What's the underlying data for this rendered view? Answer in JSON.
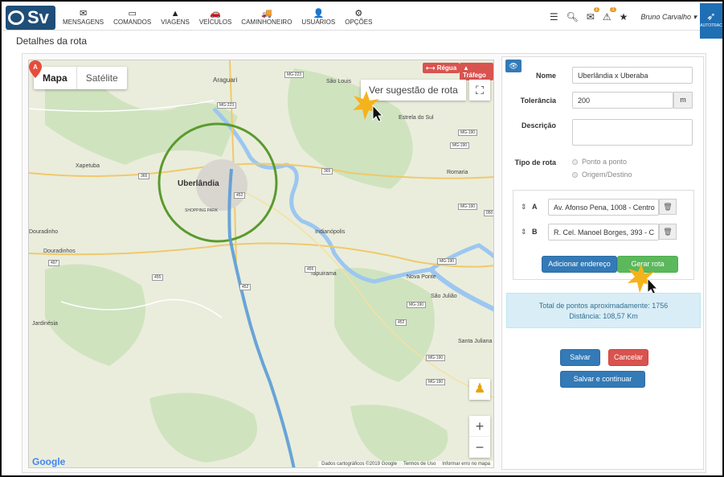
{
  "app": {
    "logo_text": "Sv",
    "user_name": "Bruno Carvalho",
    "corner_text": "AUTOTRAC"
  },
  "nav": [
    {
      "icon": "envelope-icon",
      "glyph": "✉",
      "label": "MENSAGENS"
    },
    {
      "icon": "laptop-icon",
      "glyph": "▭",
      "label": "COMANDOS"
    },
    {
      "icon": "road-icon",
      "glyph": "▲",
      "label": "VIAGENS"
    },
    {
      "icon": "car-icon",
      "glyph": "🚗",
      "label": "VEÍCULOS"
    },
    {
      "icon": "truck-icon",
      "glyph": "🚚",
      "label": "CAMINHONEIRO"
    },
    {
      "icon": "user-icon",
      "glyph": "👤",
      "label": "USUÁRIOS"
    },
    {
      "icon": "cogs-icon",
      "glyph": "⚙",
      "label": "OPÇÕES"
    }
  ],
  "tools": {
    "messages_badge": "1",
    "alerts_badge": "1"
  },
  "page": {
    "title": "Detalhes da rota"
  },
  "map": {
    "tab_map": "Mapa",
    "tab_satellite": "Satélite",
    "suggest_label": "Ver sugestão de rota",
    "ruler_label": "⟷ Régua",
    "traffic_label": "Tráfego",
    "google": "Google",
    "attribution": [
      "Dados cartográficos ©2019 Google",
      "Termos de Uso",
      "Informar erro no mapa"
    ],
    "cities": {
      "uberlandia": "Uberlândia",
      "araguari": "Araguari",
      "sao_louis": "São Louis",
      "estrela": "Estrela do Sul",
      "xapetuba": "Xapetuba",
      "romaria": "Romaria",
      "douradinho": "Douradinho",
      "douradinhos": "Douradinhos",
      "indianopolis": "Indianópolis",
      "tapuirama": "Tapuirama",
      "nova_ponte": "Nova Ponte",
      "sao_juliao": "São Julião",
      "jardinesia": "Jardinésia",
      "santa_juliana": "Santa Juliana",
      "shopping": "SHOPPING PARK",
      "monte_alegre": "ourados"
    },
    "shields": [
      "MG-223",
      "MG-223",
      "365",
      "365",
      "452",
      "497",
      "455",
      "455",
      "452",
      "MG-190",
      "MG-190",
      "MG-190",
      "MG-190",
      "MG-190",
      "MG-190",
      "MG-190",
      "452",
      "050"
    ],
    "pin_label": "A"
  },
  "form": {
    "name_label": "Nome",
    "name_value": "Uberlândia x Uberaba",
    "tolerance_label": "Tolerância",
    "tolerance_value": "200",
    "tolerance_unit": "m",
    "description_label": "Descrição",
    "description_value": "",
    "route_type_label": "Tipo de rota",
    "route_type_options": [
      "Ponto a ponto",
      "Origem/Destino"
    ],
    "route_type_selected": "Origem/Destino"
  },
  "waypoints": [
    {
      "letter": "A",
      "address": "Av. Afonso Pena, 1008 - Centro"
    },
    {
      "letter": "B",
      "address": "R. Cel. Manoel Borges, 393 - C"
    }
  ],
  "buttons": {
    "add_address": "Adicionar endereço",
    "generate_route": "Gerar rota",
    "save": "Salvar",
    "cancel": "Cancelar",
    "save_continue": "Salvar e continuar"
  },
  "summary": {
    "points_text": "Total de pontos aproximadamente: 1756",
    "distance_text": "Distância: 108,57 Km"
  }
}
